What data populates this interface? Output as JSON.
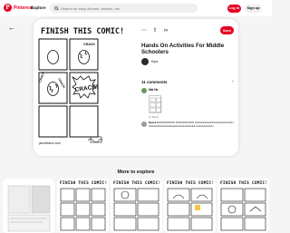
{
  "header": {
    "logo_mark": "P",
    "logo_text": "Pinterest",
    "explore_label": "Explore",
    "search_placeholder": "Search for easy dinners, fashion, etc.",
    "login_label": "Log in",
    "signup_label": "Sign up"
  },
  "pin": {
    "save_label": "Save",
    "title": "Hands On Activities For Middle Schoolers",
    "author": "Kyra",
    "image": {
      "heading": "FINISH THIS COMIC!",
      "panel_label_crack1": "CRACK",
      "panel_label_crack2": "CRACK",
      "panel_label_crack3": "CRACK",
      "panel_label_big": "CRACK!",
      "footer_site": "jaconfwlonn.com"
    }
  },
  "comments": {
    "heading": "11 comments",
    "items": [
      {
        "name": "Mai Ha",
        "meta": "2y   Reply"
      },
      {
        "name": "Bepsk",
        "text": "EDDDDDDDDD DDDDDDDDDD HNHHHHHHHHHHHHHHHHHHHHHHHHHHHHHHHHHHHHHHHHHHHHH HHHHHHHHH"
      }
    ]
  },
  "more_to_explore": "More to explore",
  "tiles": [
    {
      "title": ""
    },
    {
      "title": "FINISH THIS COMIC!"
    },
    {
      "title": "FINISH THIS COMIC!"
    },
    {
      "title": "FINISH THIS COMIC!"
    },
    {
      "title": "FINISH THIS COMIC!"
    }
  ],
  "colors": {
    "brand": "#e60023",
    "page_bg": "#f5f5f5"
  }
}
